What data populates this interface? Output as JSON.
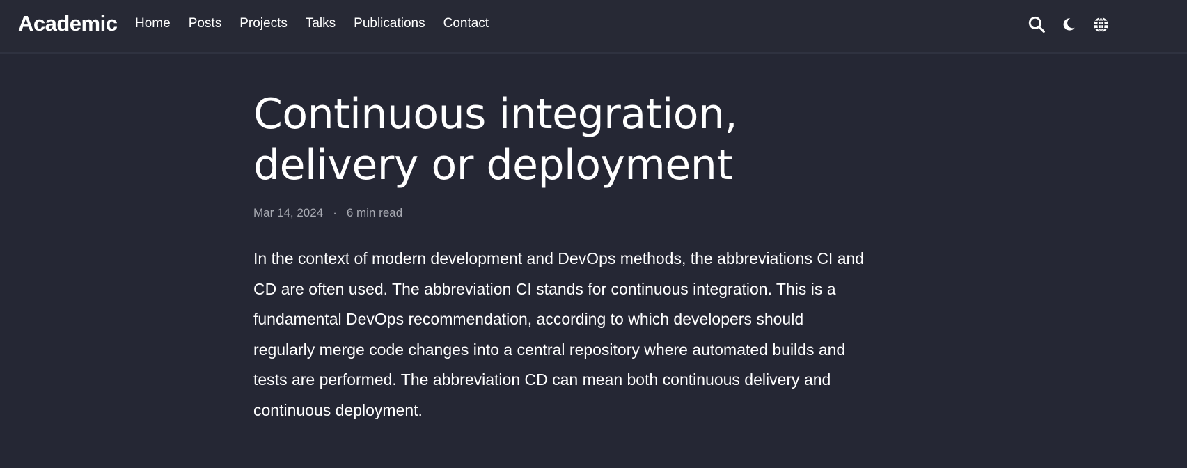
{
  "nav": {
    "brand": "Academic",
    "links": [
      "Home",
      "Posts",
      "Projects",
      "Talks",
      "Publications",
      "Contact"
    ],
    "icons": [
      "search-icon",
      "moon-icon",
      "globe-icon"
    ]
  },
  "article": {
    "title": "Continuous integration, delivery or deployment",
    "date": "Mar 14, 2024",
    "separator": "·",
    "reading_time": "6 min read",
    "summary": "In the context of modern development and DevOps methods, the abbreviations CI and CD are often used. The abbreviation CI stands for continuous integration. This is a fundamental DevOps recommendation, according to which developers should regularly merge code changes into a central repository where automated builds and tests are performed. The abbreviation CD can mean both continuous delivery and continuous deployment."
  },
  "colors": {
    "background": "#252734",
    "navbar": "#272935",
    "text": "#ffffff",
    "meta_text": "#a9abb3"
  }
}
